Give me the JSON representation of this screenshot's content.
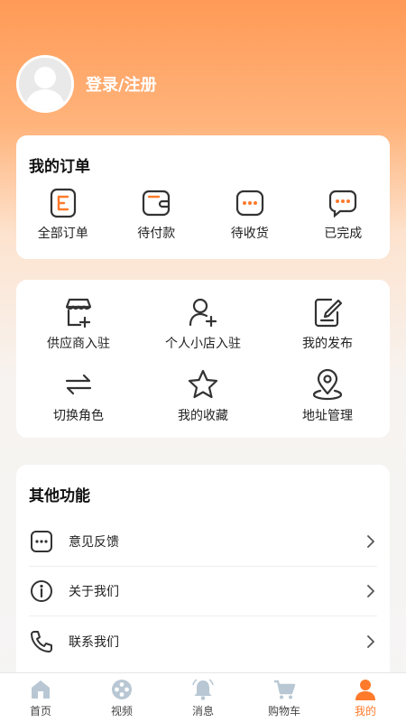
{
  "profile": {
    "login_label": "登录/注册"
  },
  "orders": {
    "title": "我的订单",
    "items": [
      {
        "label": "全部订单",
        "icon": "order-list-icon"
      },
      {
        "label": "待付款",
        "icon": "wallet-icon"
      },
      {
        "label": "待收货",
        "icon": "chat-dots-icon"
      },
      {
        "label": "已完成",
        "icon": "message-dots-icon"
      }
    ]
  },
  "services": {
    "items": [
      {
        "label": "供应商入驻",
        "icon": "store-add-icon"
      },
      {
        "label": "个人小店入驻",
        "icon": "user-add-icon"
      },
      {
        "label": "我的发布",
        "icon": "edit-document-icon"
      },
      {
        "label": "切换角色",
        "icon": "swap-icon"
      },
      {
        "label": "我的收藏",
        "icon": "star-icon"
      },
      {
        "label": "地址管理",
        "icon": "location-pin-icon"
      }
    ]
  },
  "other": {
    "title": "其他功能",
    "items": [
      {
        "label": "意见反馈",
        "icon": "feedback-icon"
      },
      {
        "label": "关于我们",
        "icon": "info-icon"
      },
      {
        "label": "联系我们",
        "icon": "phone-icon"
      }
    ]
  },
  "tabbar": {
    "items": [
      {
        "label": "首页",
        "icon": "home-icon"
      },
      {
        "label": "视频",
        "icon": "video-reel-icon"
      },
      {
        "label": "消息",
        "icon": "bell-icon"
      },
      {
        "label": "购物车",
        "icon": "cart-icon"
      },
      {
        "label": "我的",
        "icon": "person-icon",
        "active": true
      }
    ]
  },
  "colors": {
    "accent": "#ff7a2b",
    "header_gradient_top": "#ff9a57",
    "icon_tab_inactive": "#b8c7d3"
  }
}
